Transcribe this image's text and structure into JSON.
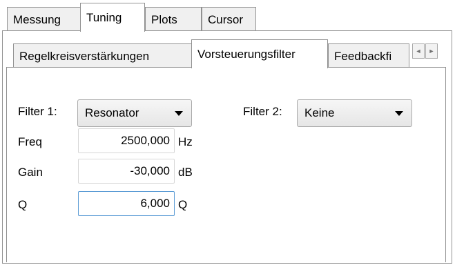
{
  "tabs": [
    "Messung",
    "Tuning",
    "Plots",
    "Cursor"
  ],
  "subtabs": [
    "Regelkreisverstärkungen",
    "Vorsteuerungsfilter",
    "Feedbackfi"
  ],
  "scroll": {
    "left": "◄",
    "right": "►"
  },
  "filter1": {
    "label": "Filter 1:",
    "value": "Resonator"
  },
  "filter2": {
    "label": "Filter 2:",
    "value": "Keine"
  },
  "params": [
    {
      "label": "Freq",
      "value": "2500,000",
      "unit": "Hz"
    },
    {
      "label": "Gain",
      "value": "-30,000",
      "unit": "dB"
    },
    {
      "label": "Q",
      "value": "6,000",
      "unit": "Q"
    }
  ]
}
